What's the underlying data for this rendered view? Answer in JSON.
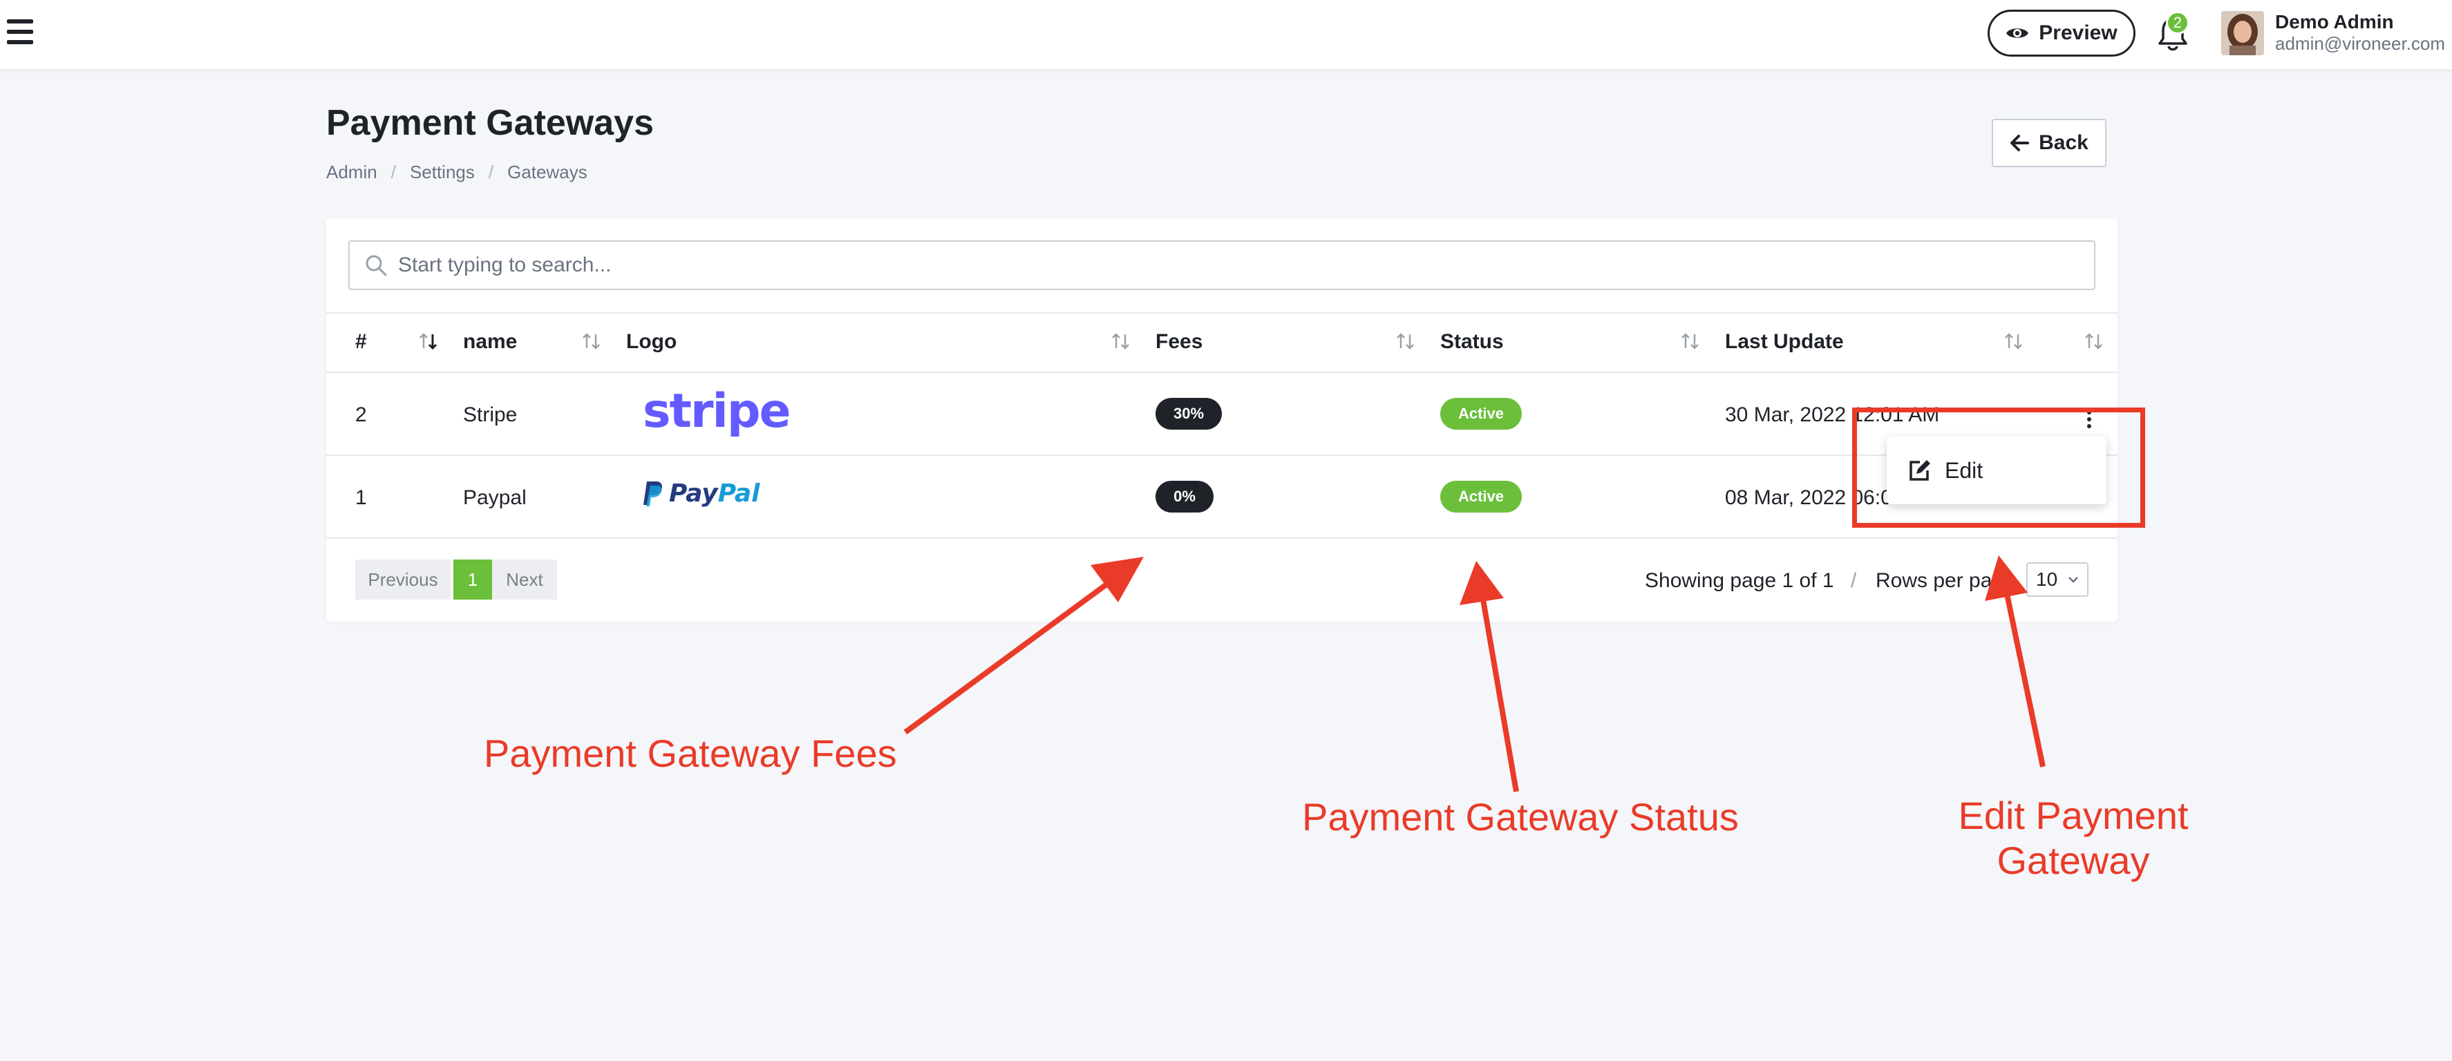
{
  "header": {
    "preview_label": "Preview",
    "notification_count": "2",
    "user": {
      "name": "Demo Admin",
      "email": "admin@vironeer.com"
    }
  },
  "page": {
    "title": "Payment Gateways",
    "breadcrumb": [
      "Admin",
      "Settings",
      "Gateways"
    ],
    "back_label": "Back"
  },
  "search": {
    "placeholder": "Start typing to search..."
  },
  "table": {
    "columns": [
      "#",
      "name",
      "Logo",
      "Fees",
      "Status",
      "Last Update"
    ],
    "rows": [
      {
        "id": "2",
        "name": "Stripe",
        "logo_text": "stripe",
        "fees": "30%",
        "status": "Active",
        "last_update": "30 Mar, 2022 12:01 AM"
      },
      {
        "id": "1",
        "name": "Paypal",
        "logo_text": "PayPal",
        "logo_text_a": "Pay",
        "logo_text_b": "Pal",
        "fees": "0%",
        "status": "Active",
        "last_update": "08 Mar, 2022 06:0"
      }
    ],
    "menu": {
      "edit_label": "Edit"
    }
  },
  "pagination": {
    "previous": "Previous",
    "current": "1",
    "next": "Next",
    "showing": "Showing page 1 of 1",
    "separator": "/",
    "rows_per_page_label": "Rows per page",
    "rows_per_page_value": "10"
  },
  "annotations": {
    "fees": "Payment Gateway Fees",
    "status": "Payment Gateway Status",
    "edit_line1": "Edit Payment",
    "edit_line2": "Gateway"
  },
  "colors": {
    "accent_green": "#6bbf3a",
    "annotation_red": "#ea3b28",
    "stripe_brand": "#635bff",
    "paypal_dark": "#253b80",
    "paypal_light": "#179bd7"
  }
}
